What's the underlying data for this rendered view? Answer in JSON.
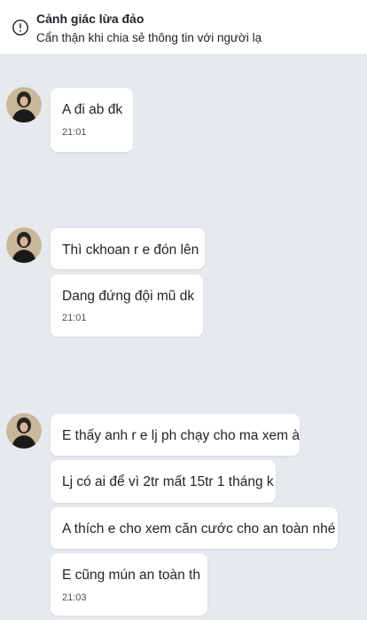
{
  "banner": {
    "icon": "alert-circle-icon",
    "title": "Cảnh giác lừa đảo",
    "subtitle": "Cẩn thận khi chia sẻ thông tin với người lạ"
  },
  "groups": [
    {
      "messages": [
        {
          "text": "A đi ab đk",
          "time": "21:01"
        }
      ]
    },
    {
      "messages": [
        {
          "text": "Thì ckhoan r e đón lên"
        },
        {
          "text": "Dang đứng đội mũ dk",
          "time": "21:01"
        }
      ]
    },
    {
      "messages": [
        {
          "text": "E thấy anh r e lj ph chạy cho ma xem à"
        },
        {
          "text": "Lj có ai để vì 2tr mất 15tr 1 tháng k"
        },
        {
          "text": "A thích e cho xem căn cước cho an toàn nhé"
        },
        {
          "text": "E cũng mún an toàn th",
          "time": "21:03"
        }
      ]
    }
  ]
}
